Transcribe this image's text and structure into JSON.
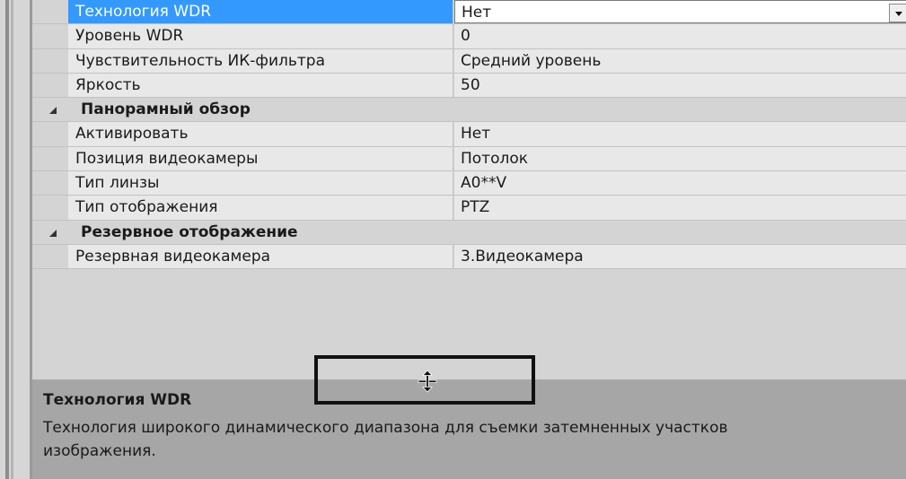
{
  "properties": [
    {
      "name": "Технология WDR",
      "value": "Нет",
      "selected": true
    },
    {
      "name": "Уровень WDR",
      "value": "0"
    },
    {
      "name": "Чувствительность ИК-фильтра",
      "value": "Средний уровень"
    },
    {
      "name": "Яркость",
      "value": "50"
    }
  ],
  "groups": {
    "panorama": {
      "title": "Панорамный обзор",
      "items": [
        {
          "name": "Активировать",
          "value": "Нет"
        },
        {
          "name": "Позиция видеокамеры",
          "value": "Потолок"
        },
        {
          "name": "Тип линзы",
          "value": "A0**V"
        },
        {
          "name": "Тип отображения",
          "value": "PTZ"
        }
      ]
    },
    "reserve": {
      "title": "Резервное отображение",
      "items": [
        {
          "name": "Резервная видеокамера",
          "value": "3.Видеокамера"
        }
      ]
    }
  },
  "description": {
    "title": "Технология WDR",
    "text": "Технология широкого динамического диапазона для съемки затемненных участков изображения."
  },
  "icons": {
    "dropdown": "chevron-down-icon",
    "collapse": "collapse-triangle-icon",
    "cursor": "move-cursor-icon"
  },
  "colors": {
    "selection": "#3399ff",
    "row_bg": "#e8e8e8",
    "description_bg": "#a6a6a6"
  }
}
